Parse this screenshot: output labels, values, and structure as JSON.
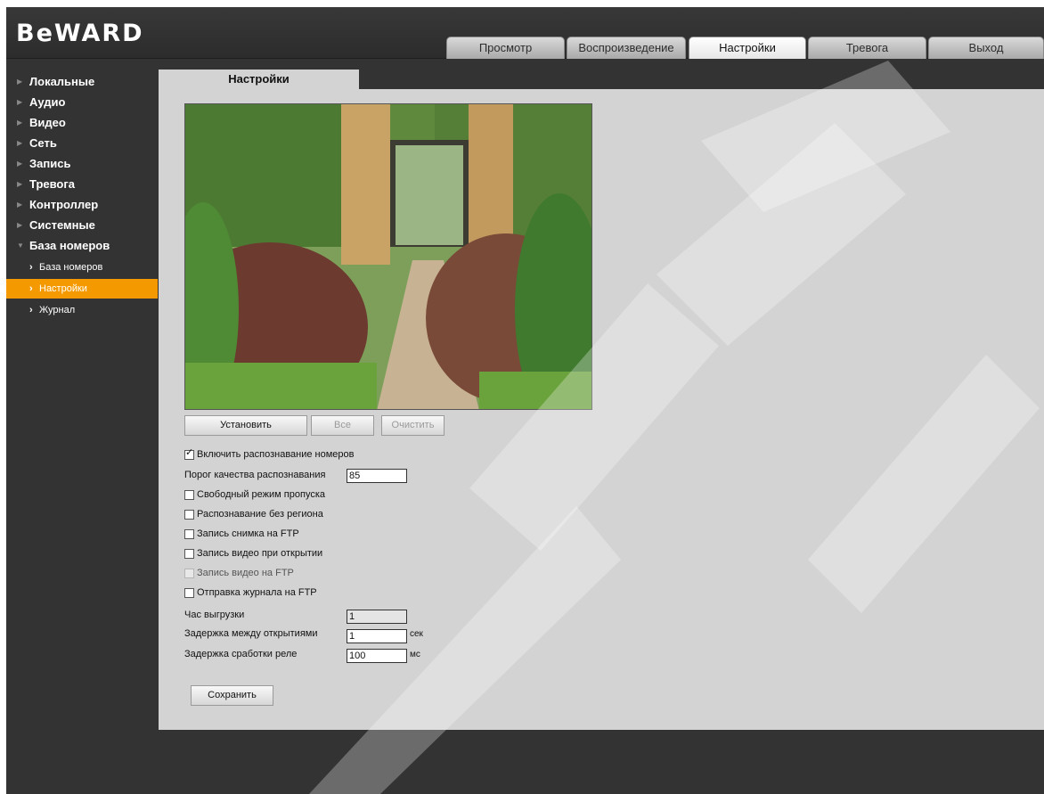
{
  "brand": {
    "logo": "BeWARD"
  },
  "nav": {
    "tabs": [
      {
        "label": "Просмотр"
      },
      {
        "label": "Воспроизведение"
      },
      {
        "label": "Настройки"
      },
      {
        "label": "Тревога"
      },
      {
        "label": "Выход"
      }
    ]
  },
  "sidebar": {
    "items": [
      {
        "label": "Локальные"
      },
      {
        "label": "Аудио"
      },
      {
        "label": "Видео"
      },
      {
        "label": "Сеть"
      },
      {
        "label": "Запись"
      },
      {
        "label": "Тревога"
      },
      {
        "label": "Контроллер"
      },
      {
        "label": "Системные"
      },
      {
        "label": "База номеров"
      }
    ],
    "subitems": [
      {
        "label": "База номеров"
      },
      {
        "label": "Настройки"
      },
      {
        "label": "Журнал"
      }
    ]
  },
  "content": {
    "tab_title": "Настройки",
    "buttons": {
      "set": "Установить",
      "all": "Все",
      "clear": "Очистить",
      "save": "Сохранить"
    },
    "enable_recognition": "Включить распознавание номеров",
    "quality_label": "Порог качества распознавания",
    "quality_value": "85",
    "checkboxes": [
      {
        "label": "Свободный режим пропуска",
        "checked": false
      },
      {
        "label": "Распознавание без региона",
        "checked": false
      },
      {
        "label": "Запись снимка на FTP",
        "checked": false
      },
      {
        "label": "Запись видео при открытии",
        "checked": false
      },
      {
        "label": "Запись видео на FTP",
        "checked": false
      },
      {
        "label": "Отправка журнала на FTP",
        "checked": false
      }
    ],
    "upload_hour_label": "Час выгрузки",
    "upload_hour_value": "1",
    "open_delay_label": "Задержка между открытиями",
    "open_delay_value": "1",
    "open_delay_unit": "сек",
    "relay_delay_label": "Задержка сработки реле",
    "relay_delay_value": "100",
    "relay_delay_unit": "мс"
  },
  "colors": {
    "accent": "#f49a00",
    "background": "#333333",
    "panel": "#d3d3d3"
  }
}
